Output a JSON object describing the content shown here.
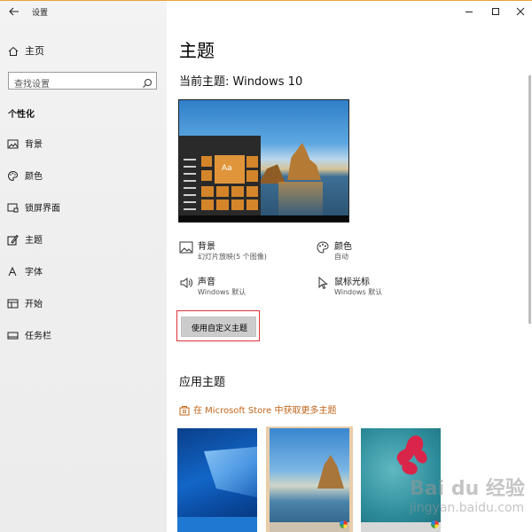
{
  "window": {
    "app_title": "设置",
    "accent": "#e8a33a"
  },
  "sidebar": {
    "home_label": "主页",
    "search_placeholder": "查找设置",
    "section_label": "个性化",
    "items": [
      {
        "label": "背景",
        "icon": "image-icon"
      },
      {
        "label": "颜色",
        "icon": "palette-icon"
      },
      {
        "label": "锁屏界面",
        "icon": "lockscreen-icon"
      },
      {
        "label": "主题",
        "icon": "theme-brush-icon",
        "active": true
      },
      {
        "label": "字体",
        "icon": "font-icon"
      },
      {
        "label": "开始",
        "icon": "start-icon"
      },
      {
        "label": "任务栏",
        "icon": "taskbar-icon"
      }
    ]
  },
  "main": {
    "page_title": "主题",
    "current_theme": "当前主题: Windows 10",
    "preview_tile_text": "Aa",
    "settings": {
      "background": {
        "title": "背景",
        "value": "幻灯片放映(5 个图像)",
        "icon": "image-icon"
      },
      "color": {
        "title": "颜色",
        "value": "自动",
        "icon": "palette-icon"
      },
      "sound": {
        "title": "声音",
        "value": "Windows 默认",
        "icon": "speaker-icon"
      },
      "cursor": {
        "title": "鼠标光标",
        "value": "Windows 默认",
        "icon": "cursor-icon"
      }
    },
    "custom_theme_button": "使用自定义主题",
    "highlight_color": "#e0313a",
    "apply_title": "应用主题",
    "store_link": "在 Microsoft Store 中获取更多主题",
    "link_color": "#c0651a",
    "theme_tiles": [
      {
        "name": "windows-10"
      },
      {
        "name": "beach",
        "selected": true
      },
      {
        "name": "flowers"
      }
    ]
  },
  "watermark": {
    "logo": "Bai du 经验",
    "sub": "jingyan.baidu.com"
  }
}
